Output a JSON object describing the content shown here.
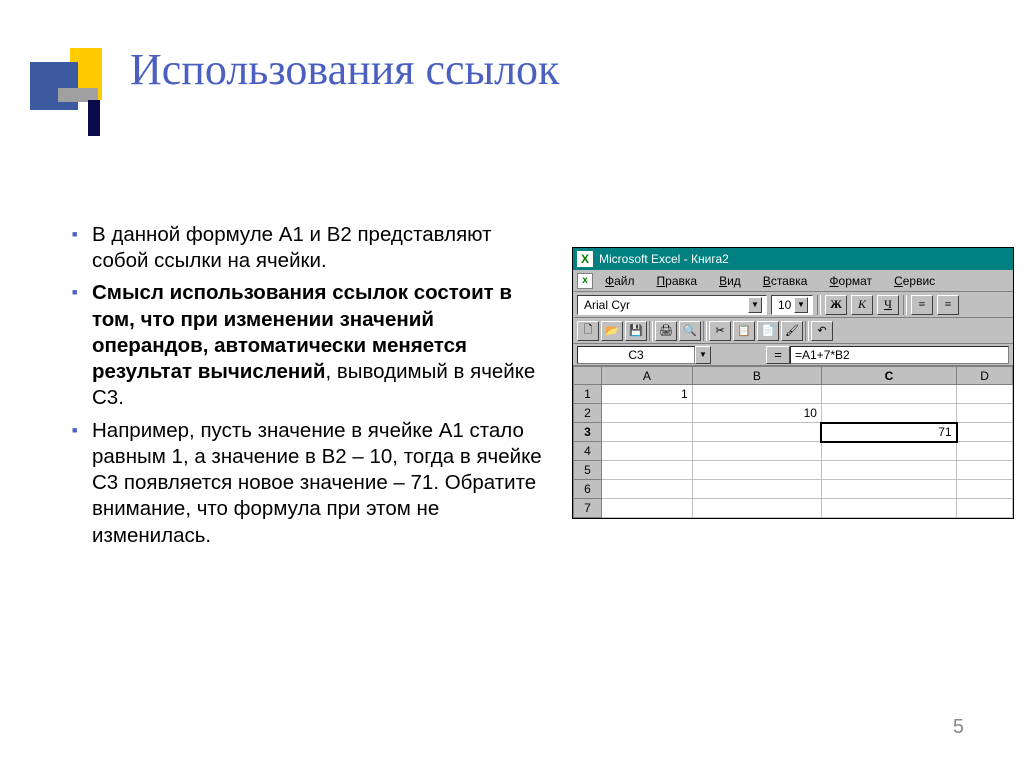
{
  "title": "Использования ссылок",
  "bullets": [
    "В данной формуле А1 и В2 представляют собой ссылки на ячейки.",
    "<b>Смысл использования ссылок состоит в том, что при изменении значений операндов, автоматически меняется результат вычислений</b>, выводимый в ячейке С3.",
    "Например, пусть значение в ячейке А1 стало равным 1, а значение в В2 – 10, тогда в ячейке С3 появляется новое значение – 71. Обратите внимание, что формула при этом не изменилась."
  ],
  "pagenum": "5",
  "excel": {
    "title": "Microsoft Excel - Книга2",
    "menus": [
      "Файл",
      "Правка",
      "Вид",
      "Вставка",
      "Формат",
      "Сервис"
    ],
    "font": "Arial Cyr",
    "fontsize": "10",
    "fmt_buttons": [
      "Ж",
      "К",
      "Ч"
    ],
    "namebox": "C3",
    "formula": "=A1+7*B2",
    "columns": [
      "A",
      "B",
      "C",
      "D"
    ],
    "rows": [
      "1",
      "2",
      "3",
      "4",
      "5",
      "6",
      "7"
    ],
    "cells": {
      "A1": "1",
      "B2": "10",
      "C3": "71"
    },
    "sel_col": "C",
    "sel_row": "3"
  }
}
